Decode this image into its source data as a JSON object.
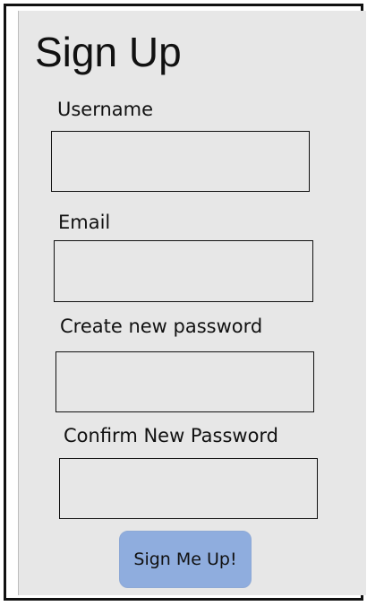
{
  "form": {
    "title": "Sign Up",
    "fields": {
      "username": {
        "label": "Username",
        "value": ""
      },
      "email": {
        "label": "Email",
        "value": ""
      },
      "new_password": {
        "label": "Create new password",
        "value": ""
      },
      "confirm_password": {
        "label": "Confirm New Password",
        "value": ""
      }
    },
    "submit_label": "Sign Me Up!"
  }
}
